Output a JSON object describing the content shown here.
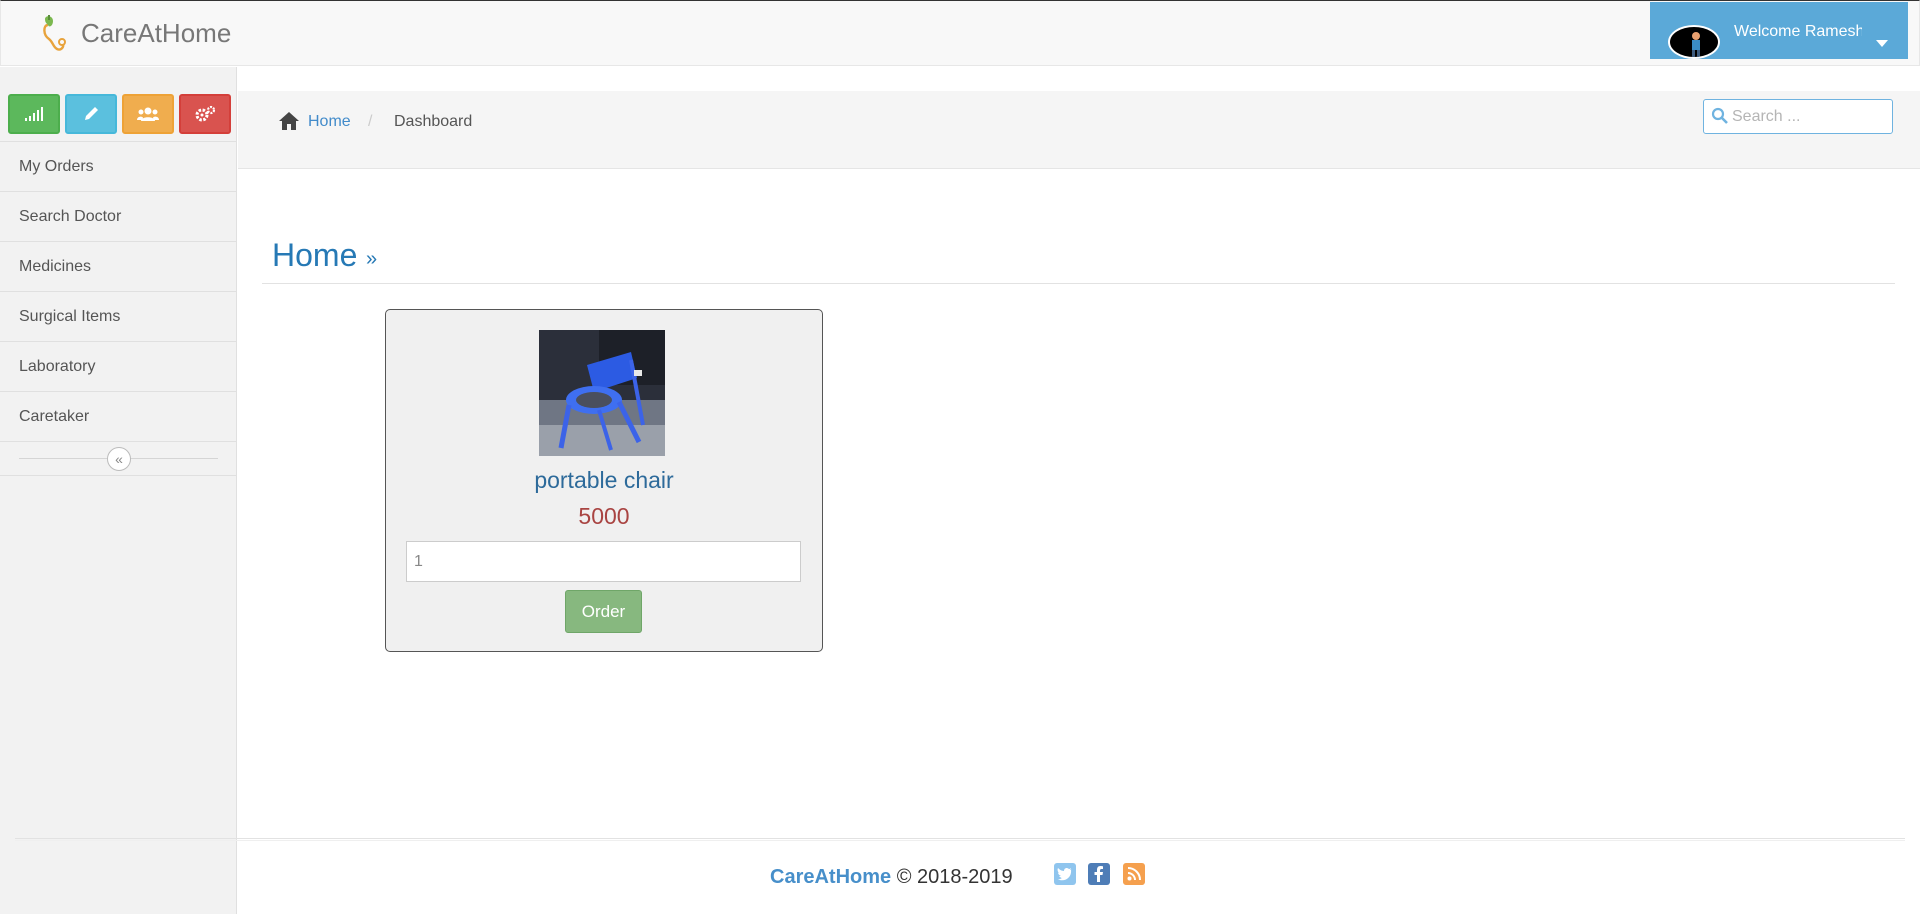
{
  "app": {
    "brand": "CareAtHome"
  },
  "user": {
    "welcome": "Welcome Rameshe"
  },
  "sidebar": {
    "items": [
      {
        "label": "My Orders"
      },
      {
        "label": "Search Doctor"
      },
      {
        "label": "Medicines"
      },
      {
        "label": "Surgical Items"
      },
      {
        "label": "Laboratory"
      },
      {
        "label": "Caretaker"
      }
    ]
  },
  "breadcrumb": {
    "home": "Home",
    "separator": "/",
    "current": "Dashboard"
  },
  "search": {
    "placeholder": "Search ...",
    "value": ""
  },
  "page": {
    "title": "Home",
    "arrow": "»"
  },
  "product": {
    "name": "portable chair",
    "price": "5000",
    "quantity": "1",
    "order_label": "Order"
  },
  "footer": {
    "brand": "CareAtHome",
    "copyright": "© 2018-2019"
  },
  "colors": {
    "accent": "#5ba9d8",
    "link": "#428bca",
    "price": "#a94442",
    "order_button": "#87b87f"
  },
  "icons": {
    "shortcuts": [
      "signal-icon",
      "pencil-icon",
      "users-icon",
      "cogs-icon"
    ],
    "social": [
      "twitter-icon",
      "facebook-icon",
      "rss-icon"
    ]
  }
}
